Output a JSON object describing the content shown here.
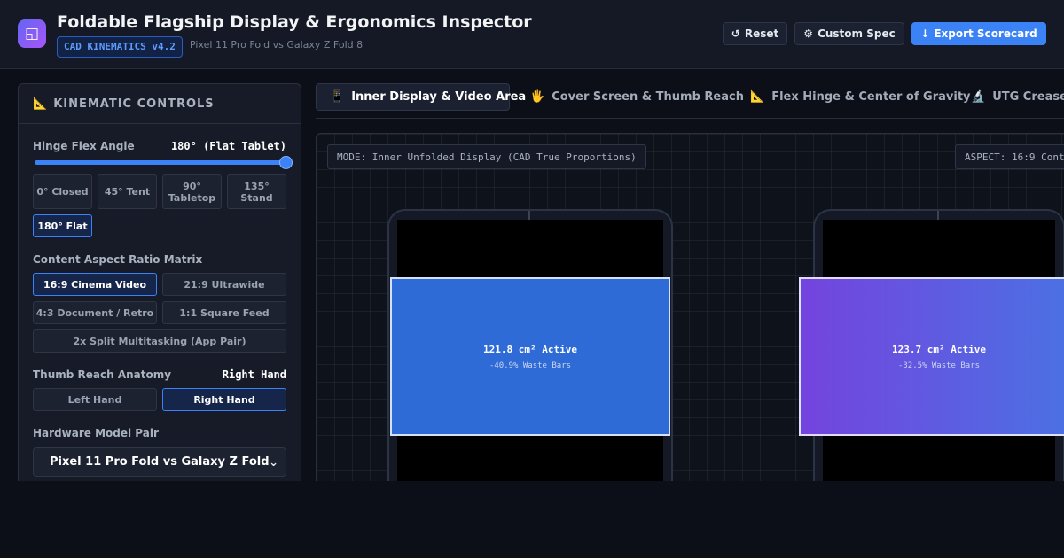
{
  "header": {
    "logo_glyph": "◱",
    "title": "Foldable Flagship Display & Ergonomics Inspector",
    "version_badge": "CAD KINEMATICS v4.2",
    "subtitle": "Pixel 11 Pro Fold vs Galaxy Z Fold 8",
    "reset": {
      "icon": "reset-icon",
      "glyph": "↺",
      "label": "Reset"
    },
    "custom_spec": {
      "icon": "gear-icon",
      "glyph": "⚙",
      "label": "Custom Spec"
    },
    "export": {
      "icon": "download-icon",
      "glyph": "↓",
      "label": "Export Scorecard"
    }
  },
  "sidebar": {
    "title_glyph": "📐",
    "title": "KINEMATIC CONTROLS",
    "hinge": {
      "label": "Hinge Flex Angle",
      "value": "180° (Flat Tablet)",
      "slider_fraction": 1.0,
      "presets": [
        {
          "line1": "0° Closed",
          "line2": ""
        },
        {
          "line1": "45° Tent",
          "line2": ""
        },
        {
          "line1": "90°",
          "line2": "Tabletop"
        },
        {
          "line1": "135°",
          "line2": "Stand"
        },
        {
          "line1": "180° Flat",
          "line2": ""
        }
      ],
      "active_preset": "180° Flat"
    },
    "aspect": {
      "label": "Content Aspect Ratio Matrix",
      "options": [
        "16:9 Cinema Video",
        "21:9 Ultrawide",
        "4:3 Document / Retro",
        "1:1 Square Feed",
        "2x Split Multitasking (App Pair)"
      ],
      "active": "16:9 Cinema Video"
    },
    "thumb": {
      "label": "Thumb Reach Anatomy",
      "value": "Right Hand",
      "options": [
        "Left Hand",
        "Right Hand"
      ],
      "active": "Right Hand"
    },
    "model": {
      "label": "Hardware Model Pair",
      "selected": "Pixel 11 Pro Fold vs Galaxy Z Fold",
      "chevron": "⌄"
    }
  },
  "tabs": [
    {
      "glyph": "📱",
      "icon": "phone-icon",
      "label": "Inner Display & Video Area",
      "active": true
    },
    {
      "glyph": "🖐",
      "icon": "hand-icon",
      "label": "Cover Screen & Thumb Reach",
      "active": false
    },
    {
      "glyph": "📐",
      "icon": "ruler-icon",
      "label": "Flex Hinge & Center of Gravity",
      "active": false
    },
    {
      "glyph": "🔬",
      "icon": "microscope-icon",
      "label": "UTG Crease C",
      "active": false
    }
  ],
  "viewport": {
    "mode_tag": "MODE: Inner Unfolded Display (CAD True Proportions)",
    "aspect_tag": "ASPECT: 16:9 Cont",
    "devices": [
      {
        "active_area": "121.8 cm² Active",
        "waste": "-40.9% Waste Bars",
        "color": "#2f6bd6"
      },
      {
        "active_area": "123.7 cm² Active",
        "waste": "-32.5% Waste Bars",
        "color": "#7444de"
      }
    ]
  },
  "colors": {
    "accent": "#3b82f6",
    "background": "#0c0f17",
    "panel": "#161b27"
  }
}
